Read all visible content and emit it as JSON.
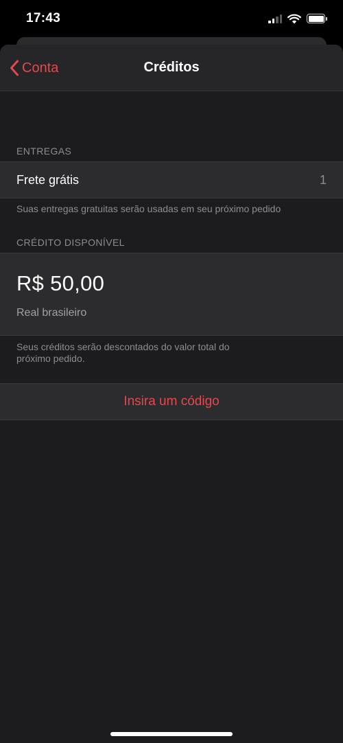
{
  "status_bar": {
    "time": "17:43",
    "icons": [
      "signal-icon",
      "wifi-icon",
      "battery-icon"
    ]
  },
  "nav": {
    "back_label": "Conta",
    "title": "Créditos"
  },
  "deliveries": {
    "header": "ENTREGAS",
    "item_label": "Frete grátis",
    "item_count": "1",
    "footer": "Suas entregas gratuitas serão usadas em seu próximo pedido"
  },
  "credit": {
    "header": "CRÉDITO DISPONÍVEL",
    "amount": "R$ 50,00",
    "currency": "Real brasileiro",
    "footer": "Seus créditos serão descontados do valor total do próximo pedido."
  },
  "actions": {
    "enter_code_label": "Insira um código"
  },
  "colors": {
    "accent": "#e5484d",
    "background": "#1c1c1e",
    "row_background": "#2c2c2e",
    "secondary_text": "#8d8d92"
  }
}
